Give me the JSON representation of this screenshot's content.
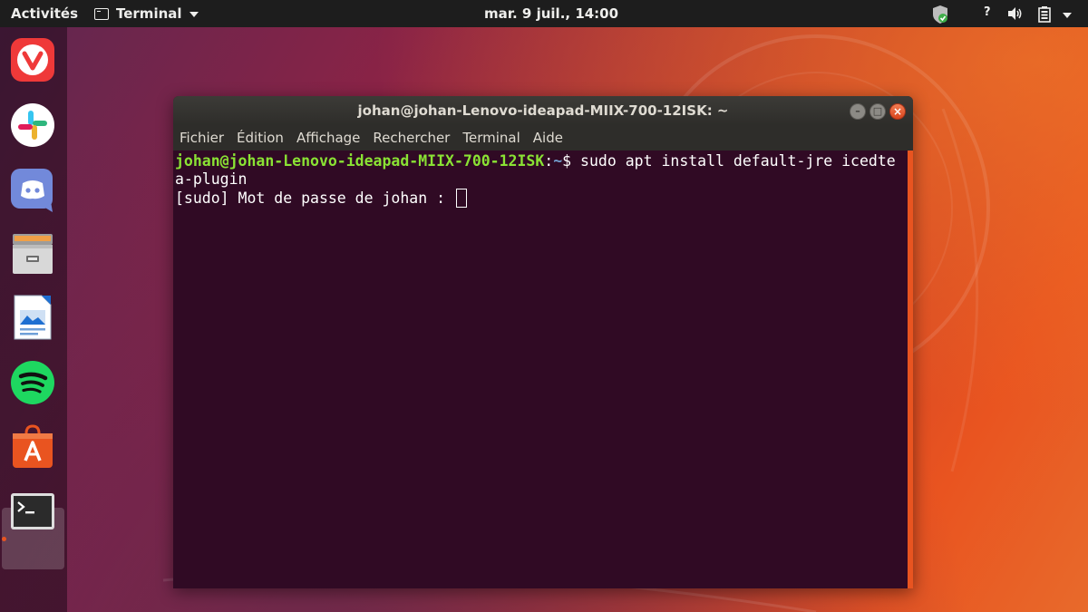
{
  "topbar": {
    "activities": "Activités",
    "app_name": "Terminal",
    "clock": "mar.  9 juil., 14:00",
    "help": "?"
  },
  "dock": {
    "items": [
      {
        "name": "vivaldi-icon"
      },
      {
        "name": "slack-icon"
      },
      {
        "name": "discord-icon"
      },
      {
        "name": "files-icon"
      },
      {
        "name": "writer-icon"
      },
      {
        "name": "spotify-icon"
      },
      {
        "name": "software-icon"
      },
      {
        "name": "terminal-icon"
      }
    ]
  },
  "window": {
    "title": "johan@johan-Lenovo-ideapad-MIIX-700-12ISK: ~",
    "menu": [
      "Fichier",
      "Édition",
      "Affichage",
      "Rechercher",
      "Terminal",
      "Aide"
    ],
    "terminal": {
      "prompt_user": "johan@johan-Lenovo-ideapad-MIIX-700-12ISK",
      "prompt_sep": ":",
      "prompt_path": "~",
      "prompt_end": "$ ",
      "command_line1": "sudo apt install default-jre icedte",
      "command_line2": "a-plugin",
      "sudo_prompt": "[sudo] Mot de passe de johan : "
    }
  },
  "colors": {
    "ubuntu_orange": "#e95420",
    "terminal_bg": "#300a24",
    "prompt_green": "#8ae234",
    "prompt_blue": "#729fcf"
  }
}
